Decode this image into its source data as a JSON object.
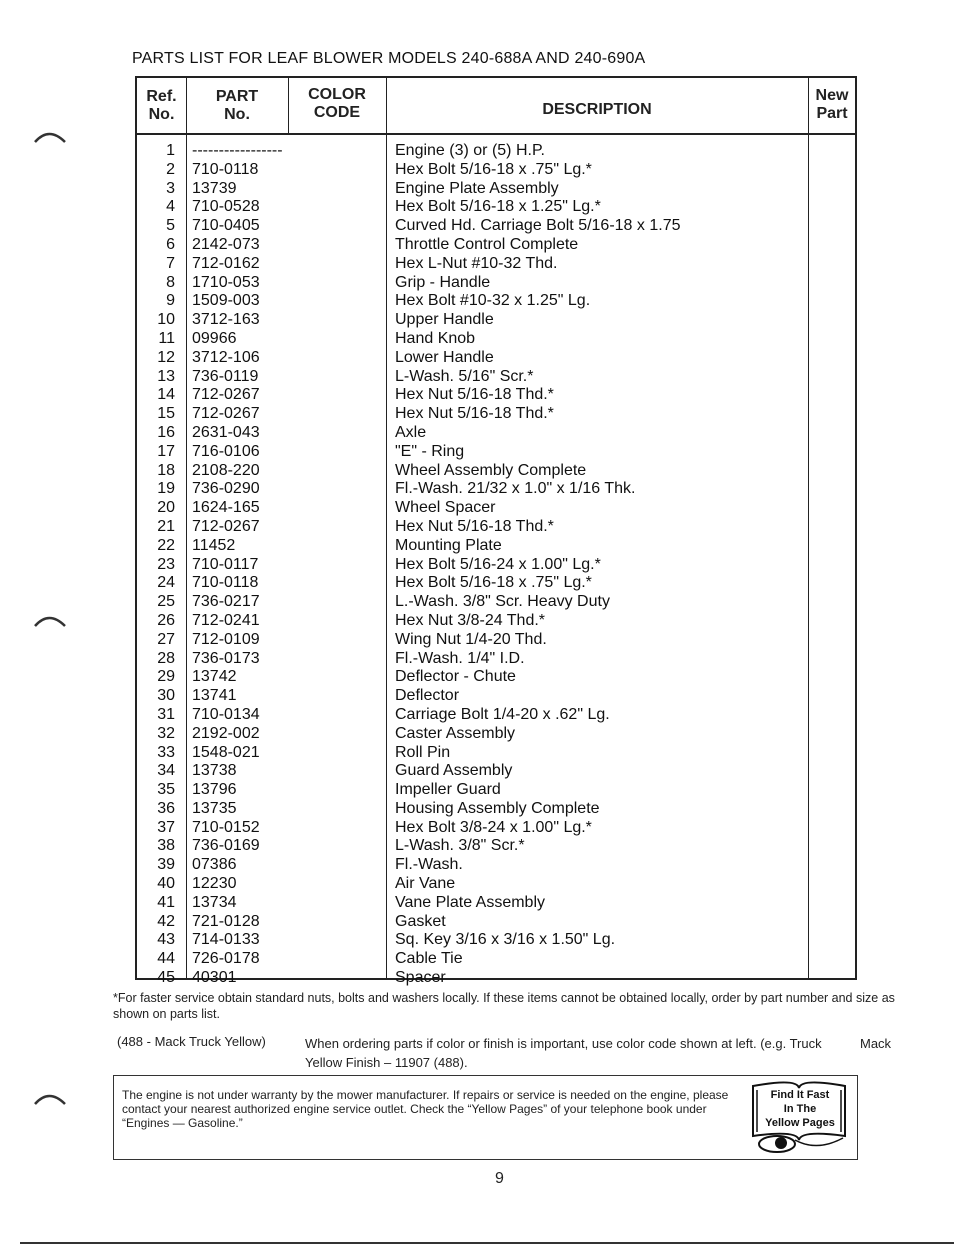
{
  "document": {
    "title": "PARTS LIST FOR LEAF BLOWER MODELS 240-688A AND 240-690A",
    "page_number": "9"
  },
  "table": {
    "headers": {
      "ref_no": [
        "Ref.",
        "No."
      ],
      "part_no": [
        "PART",
        "No."
      ],
      "color_code": [
        "COLOR",
        "CODE"
      ],
      "description": "DESCRIPTION",
      "new_part": [
        "New",
        "Part"
      ]
    },
    "rows": [
      {
        "ref": "1",
        "part": "-----------------",
        "desc": "Engine (3) or (5) H.P."
      },
      {
        "ref": "2",
        "part": "710-0118",
        "desc": "Hex Bolt 5/16-18 x .75\" Lg.*"
      },
      {
        "ref": "3",
        "part": "13739",
        "desc": "Engine Plate Assembly"
      },
      {
        "ref": "4",
        "part": "710-0528",
        "desc": "Hex Bolt 5/16-18 x 1.25\" Lg.*"
      },
      {
        "ref": "5",
        "part": "710-0405",
        "desc": "Curved Hd. Carriage Bolt 5/16-18 x 1.75"
      },
      {
        "ref": "6",
        "part": "2142-073",
        "desc": "Throttle Control Complete"
      },
      {
        "ref": "7",
        "part": "712-0162",
        "desc": "Hex L-Nut #10-32 Thd."
      },
      {
        "ref": "8",
        "part": "1710-053",
        "desc": "Grip - Handle"
      },
      {
        "ref": "9",
        "part": "1509-003",
        "desc": "Hex Bolt #10-32 x 1.25\" Lg."
      },
      {
        "ref": "10",
        "part": "3712-163",
        "desc": "Upper Handle"
      },
      {
        "ref": "11",
        "part": "09966",
        "desc": "Hand Knob"
      },
      {
        "ref": "12",
        "part": "3712-106",
        "desc": "Lower Handle"
      },
      {
        "ref": "13",
        "part": "736-0119",
        "desc": "L-Wash. 5/16\" Scr.*"
      },
      {
        "ref": "14",
        "part": "712-0267",
        "desc": "Hex Nut 5/16-18 Thd.*"
      },
      {
        "ref": "15",
        "part": "712-0267",
        "desc": "Hex Nut 5/16-18 Thd.*"
      },
      {
        "ref": "16",
        "part": "2631-043",
        "desc": "Axle"
      },
      {
        "ref": "17",
        "part": "716-0106",
        "desc": "\"E\" - Ring"
      },
      {
        "ref": "18",
        "part": "2108-220",
        "desc": "Wheel Assembly Complete"
      },
      {
        "ref": "19",
        "part": "736-0290",
        "desc": "Fl.-Wash. 21/32 x 1.0\" x 1/16 Thk."
      },
      {
        "ref": "20",
        "part": "1624-165",
        "desc": "Wheel Spacer"
      },
      {
        "ref": "21",
        "part": "712-0267",
        "desc": "Hex Nut 5/16-18 Thd.*"
      },
      {
        "ref": "22",
        "part": "11452",
        "desc": "Mounting Plate"
      },
      {
        "ref": "23",
        "part": "710-0117",
        "desc": "Hex Bolt 5/16-24 x 1.00\" Lg.*"
      },
      {
        "ref": "24",
        "part": "710-0118",
        "desc": "Hex Bolt 5/16-18 x .75\" Lg.*"
      },
      {
        "ref": "25",
        "part": "736-0217",
        "desc": "L.-Wash. 3/8\" Scr. Heavy Duty"
      },
      {
        "ref": "26",
        "part": "712-0241",
        "desc": "Hex Nut 3/8-24 Thd.*"
      },
      {
        "ref": "27",
        "part": "712-0109",
        "desc": "Wing Nut 1/4-20 Thd."
      },
      {
        "ref": "28",
        "part": "736-0173",
        "desc": "Fl.-Wash. 1/4\" I.D."
      },
      {
        "ref": "29",
        "part": "13742",
        "desc": "Deflector - Chute"
      },
      {
        "ref": "30",
        "part": "13741",
        "desc": "Deflector"
      },
      {
        "ref": "31",
        "part": "710-0134",
        "desc": "Carriage Bolt 1/4-20 x .62\" Lg."
      },
      {
        "ref": "32",
        "part": "2192-002",
        "desc": "Caster Assembly"
      },
      {
        "ref": "33",
        "part": "1548-021",
        "desc": "Roll Pin"
      },
      {
        "ref": "34",
        "part": "13738",
        "desc": "Guard Assembly"
      },
      {
        "ref": "35",
        "part": "13796",
        "desc": "Impeller Guard"
      },
      {
        "ref": "36",
        "part": "13735",
        "desc": "Housing Assembly Complete"
      },
      {
        "ref": "37",
        "part": "710-0152",
        "desc": "Hex Bolt 3/8-24 x 1.00\" Lg.*"
      },
      {
        "ref": "38",
        "part": "736-0169",
        "desc": "L-Wash. 3/8\" Scr.*"
      },
      {
        "ref": "39",
        "part": "07386",
        "desc": "Fl.-Wash."
      },
      {
        "ref": "40",
        "part": "12230",
        "desc": "Air Vane"
      },
      {
        "ref": "41",
        "part": "13734",
        "desc": "Vane Plate Assembly"
      },
      {
        "ref": "42",
        "part": "721-0128",
        "desc": "Gasket"
      },
      {
        "ref": "43",
        "part": "714-0133",
        "desc": "Sq. Key 3/16 x 3/16 x 1.50\" Lg."
      },
      {
        "ref": "44",
        "part": "726-0178",
        "desc": "Cable Tie"
      },
      {
        "ref": "45",
        "part": "40301",
        "desc": "Spacer"
      }
    ]
  },
  "notes": {
    "footnote": "*For faster service obtain standard nuts, bolts and washers locally. If these items cannot be obtained locally, order by part number and size as shown on parts list.",
    "color_label": "(488 - Mack Truck Yellow)",
    "color_text": "When ordering parts if color or finish is important, use color code shown at left. (e.g. Truck Yellow Finish – 11907 (488).",
    "color_extra": "Mack"
  },
  "warranty": {
    "text": "The engine is not under warranty by the mower manufacturer. If repairs or service is needed on the engine, please contact your nearest authorized engine service outlet. Check the “Yellow Pages” of your telephone book under “Engines — Gasoline.”",
    "badge_lines": [
      "Find It Fast",
      "In The",
      "Yellow Pages"
    ],
    "badge_icon": "book-telephone-icon"
  }
}
